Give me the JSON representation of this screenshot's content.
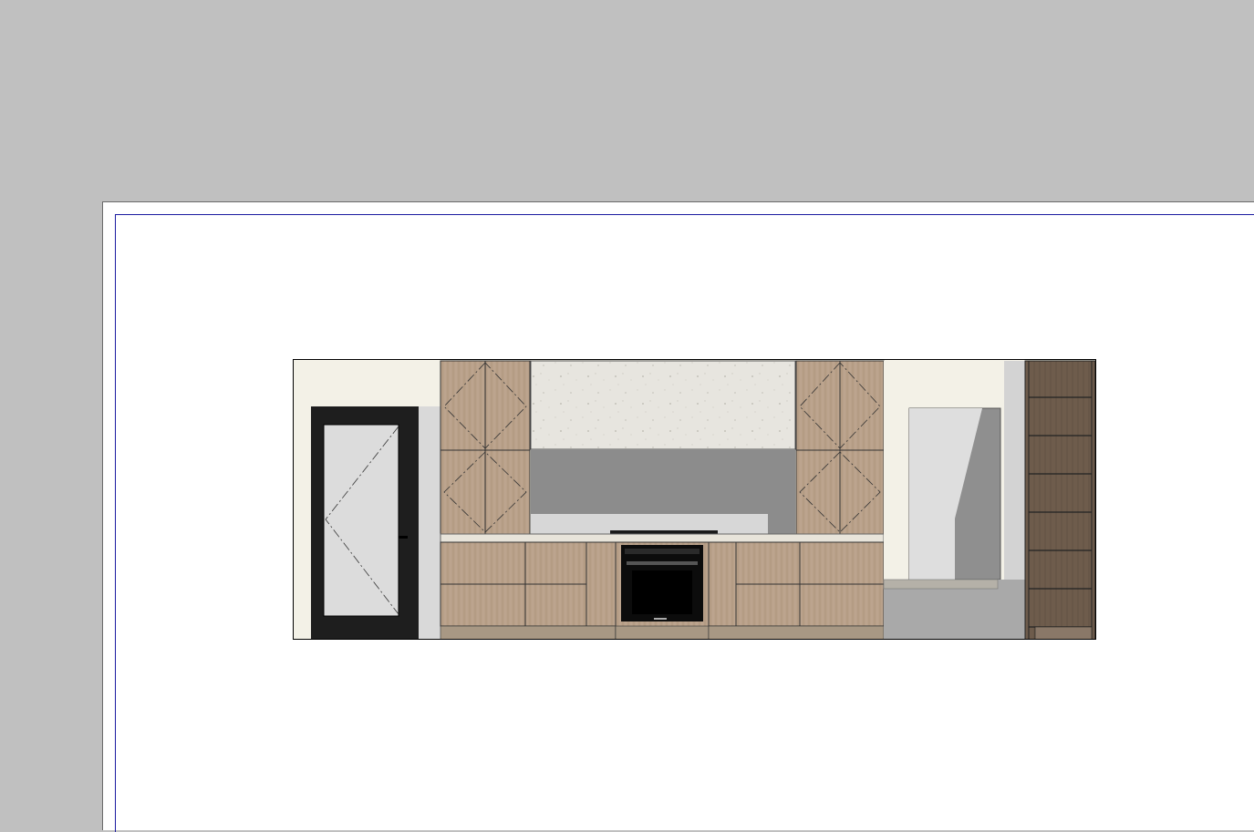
{
  "window": {
    "canvas_background": "#c0c0c0",
    "sheet_background": "#ffffff",
    "sheet_border_color": "#1a1aa0"
  },
  "view": {
    "type": "kitchen-elevation",
    "elements": [
      "left-door",
      "upper-wall-cabinet-left",
      "stone-backsplash-panel",
      "upper-wall-cabinet-right",
      "countertop",
      "base-cabinets-left",
      "built-in-oven",
      "base-cabinets-right",
      "wall-niche",
      "tall-shelving-unit"
    ],
    "colors": {
      "wall": "#f3f1e7",
      "wood": "#b8a088",
      "dark_wood": "#6b5a4a",
      "door_frame": "#1e1e1e",
      "glass": "#dcdcdc",
      "stone": "#e8e6e0",
      "shadow": "#8c8c8c",
      "oven": "#0c0c0c"
    }
  }
}
